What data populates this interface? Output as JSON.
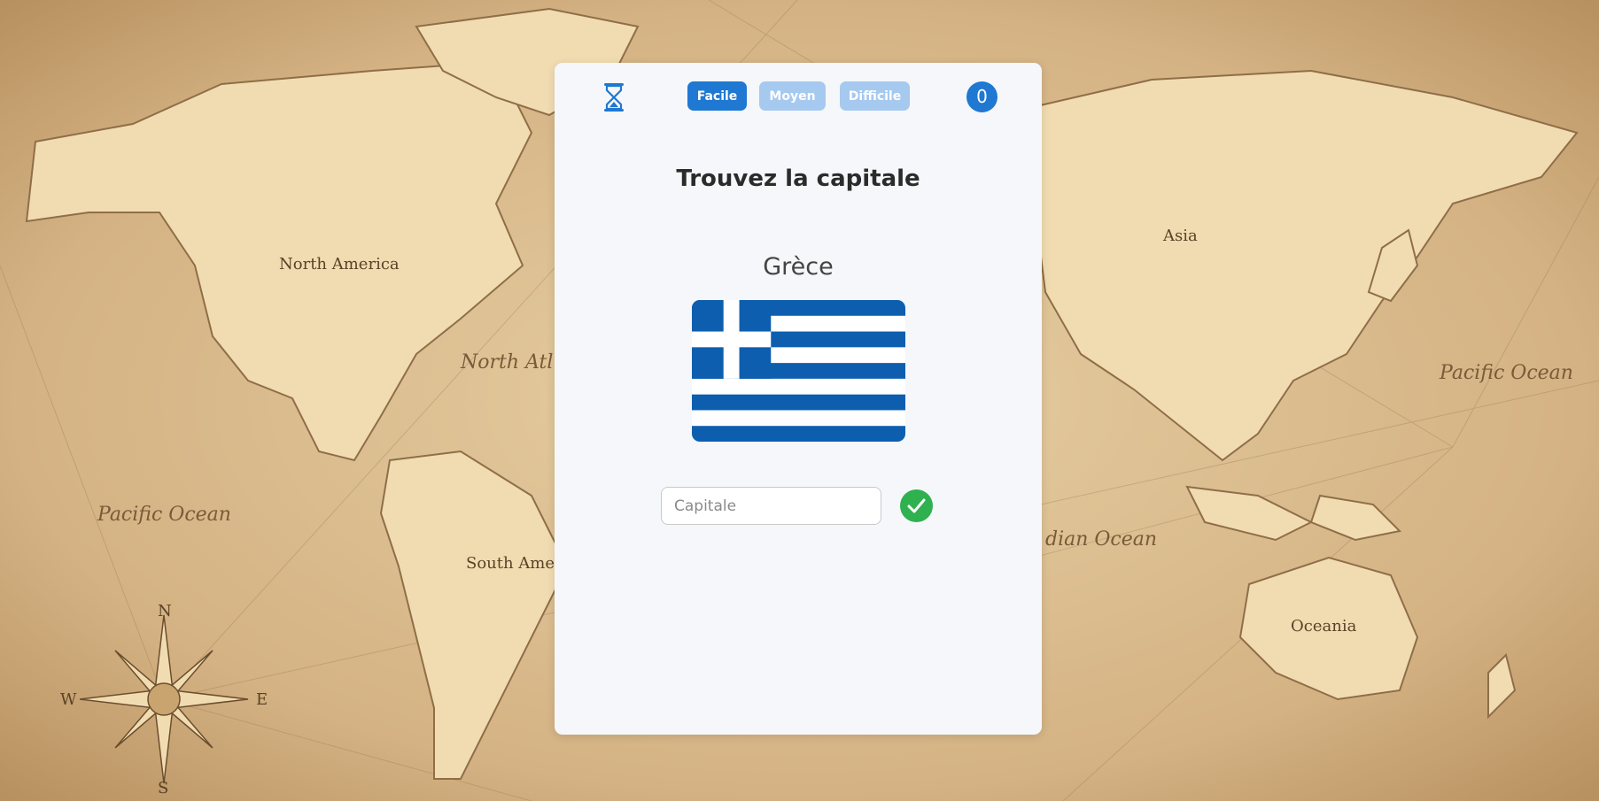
{
  "game": {
    "levels": [
      {
        "label": "Facile",
        "active": true
      },
      {
        "label": "Moyen",
        "active": false
      },
      {
        "label": "Difficile",
        "active": false
      }
    ],
    "score": "0",
    "title": "Trouvez la capitale",
    "country": "Grèce",
    "flag_icon": "greece-flag",
    "answer": {
      "value": "",
      "placeholder": "Capitale"
    },
    "submit_icon": "check-icon"
  },
  "map": {
    "labels": {
      "north_america": "North America",
      "north_atlantic": "North Atl",
      "south_america": "South Amer",
      "asia": "Asia",
      "pacific_left": "Pacific Ocean",
      "pacific_right": "Pacific Ocean",
      "indian": "dian Ocean",
      "oceania": "Oceania",
      "compass_n": "N",
      "compass_s": "S",
      "compass_e": "E",
      "compass_w": "W"
    }
  },
  "colors": {
    "primary": "#1f78d1",
    "primary_light": "#a6c9ef",
    "success": "#2fb14f",
    "card_bg": "#f5f7fa",
    "flag_blue": "#0d5eaf"
  }
}
